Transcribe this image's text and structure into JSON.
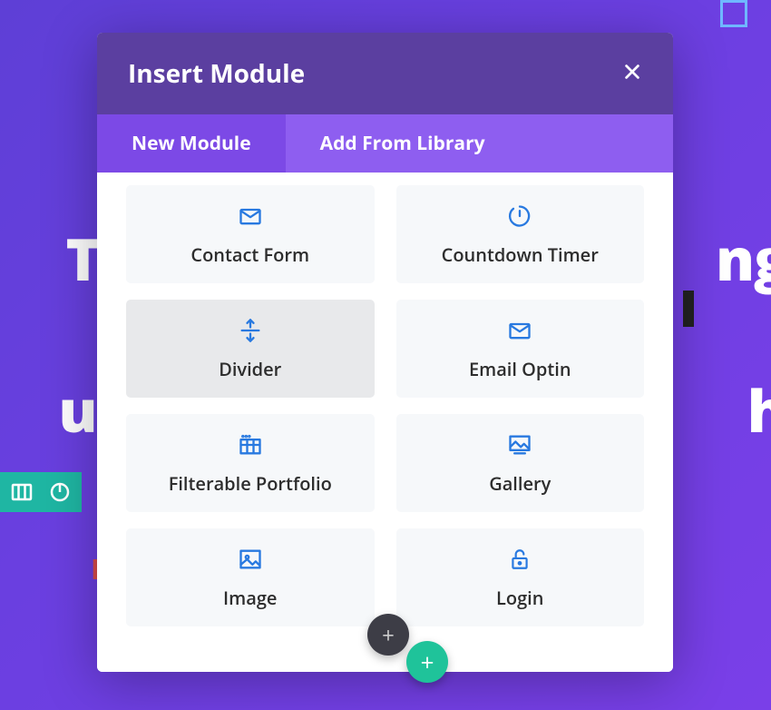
{
  "background": {
    "line1": "To",
    "line1b": "ngo",
    "line2a": "uil",
    "line2b": "he",
    "redText": "D"
  },
  "modal": {
    "title": "Insert Module",
    "tabs": {
      "active": "New Module",
      "inactive": "Add From Library"
    },
    "modules": [
      {
        "label": "Contact Form",
        "icon": "mail"
      },
      {
        "label": "Countdown Timer",
        "icon": "countdown"
      },
      {
        "label": "Divider",
        "icon": "divider",
        "hover": true
      },
      {
        "label": "Email Optin",
        "icon": "mail"
      },
      {
        "label": "Filterable Portfolio",
        "icon": "grid"
      },
      {
        "label": "Gallery",
        "icon": "gallery"
      },
      {
        "label": "Image",
        "icon": "image"
      },
      {
        "label": "Login",
        "icon": "lock"
      }
    ]
  },
  "buttons": {
    "plusDark": "+",
    "plusGreen": "+"
  }
}
